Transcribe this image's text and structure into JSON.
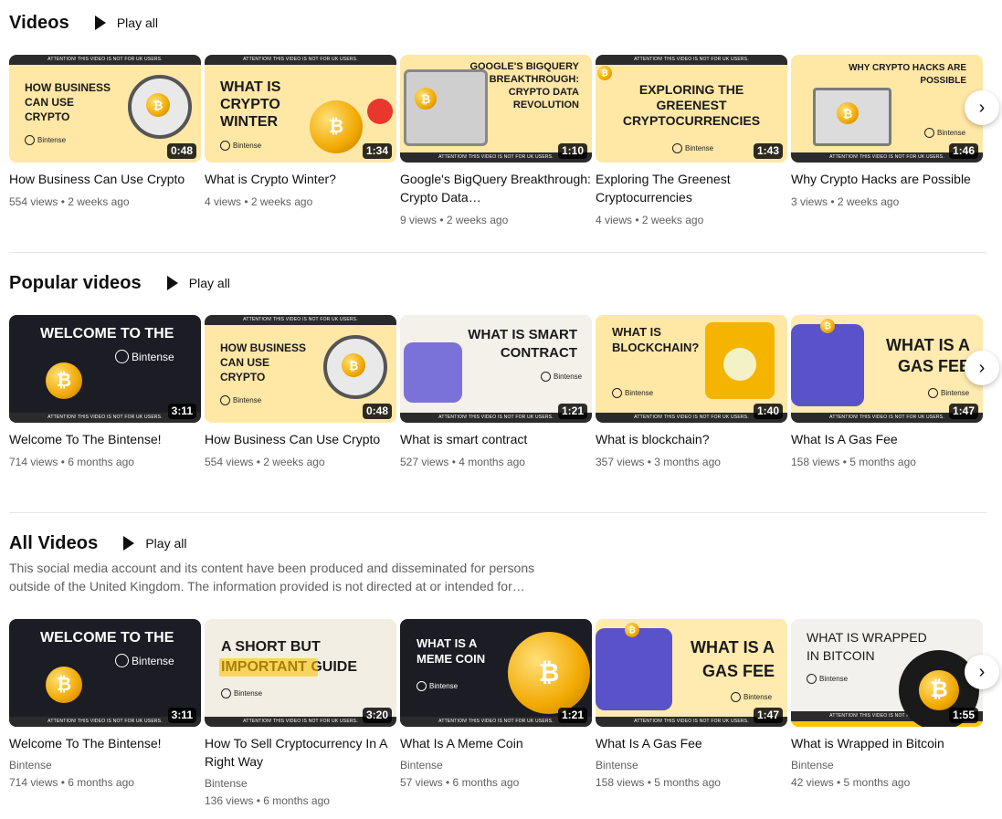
{
  "sections": [
    {
      "title": "Videos",
      "play_all": "Play all",
      "videos": [
        {
          "thumb_text": "HOW BUSINESS\nCAN USE\nCRYPTO",
          "attention": "ATTENTION! THIS VIDEO IS NOT FOR UK USERS.",
          "brand": "Bintense",
          "duration": "0:48",
          "title": "How Business Can Use Crypto",
          "meta": "554 views • 2 weeks ago"
        },
        {
          "thumb_text": "WHAT IS\nCRYPTO\nWINTER",
          "attention": "ATTENTION! THIS VIDEO IS NOT FOR UK USERS.",
          "brand": "Bintense",
          "duration": "1:34",
          "title": "What is Crypto Winter?",
          "meta": "4 views • 2 weeks ago"
        },
        {
          "thumb_text": "GOOGLE'S BIGQUERY\nBREAKTHROUGH:\nCRYPTO DATA\nREVOLUTION",
          "attention": "ATTENTION! THIS VIDEO IS NOT FOR UK USERS.",
          "brand": "",
          "duration": "1:10",
          "title": "Google's BigQuery Breakthrough: Crypto Data…",
          "meta": "9 views • 2 weeks ago"
        },
        {
          "thumb_text": "EXPLORING THE\nGREENEST\nCRYPTOCURRENCIES",
          "attention": "ATTENTION! THIS VIDEO IS NOT FOR UK USERS.",
          "brand": "Bintense",
          "duration": "1:43",
          "title": "Exploring The Greenest Cryptocurrencies",
          "meta": "4 views • 2 weeks ago"
        },
        {
          "thumb_text": "WHY CRYPTO HACKS ARE\nPOSSIBLE",
          "attention": "ATTENTION! THIS VIDEO IS NOT FOR UK USERS.",
          "brand": "Bintense",
          "duration": "1:46",
          "title": "Why Crypto Hacks are Possible",
          "meta": "3 views • 2 weeks ago"
        }
      ]
    },
    {
      "title": "Popular videos",
      "play_all": "Play all",
      "videos": [
        {
          "thumb_text": "WELCOME TO THE",
          "attention": "ATTENTION! THIS VIDEO IS NOT FOR UK USERS.",
          "brand": "Bintense",
          "duration": "3:11",
          "title": "Welcome To The Bintense!",
          "meta": "714 views • 6 months ago"
        },
        {
          "thumb_text": "HOW BUSINESS\nCAN USE\nCRYPTO",
          "attention": "ATTENTION! THIS VIDEO IS NOT FOR UK USERS.",
          "brand": "Bintense",
          "duration": "0:48",
          "title": "How Business Can Use Crypto",
          "meta": "554 views • 2 weeks ago"
        },
        {
          "thumb_text": "WHAT IS SMART\nCONTRACT",
          "attention": "ATTENTION! THIS VIDEO IS NOT FOR UK USERS.",
          "brand": "Bintense",
          "duration": "1:21",
          "title": "What is smart contract",
          "meta": "527 views • 4 months ago"
        },
        {
          "thumb_text": "WHAT IS\nBLOCKCHAIN?",
          "attention": "ATTENTION! THIS VIDEO IS NOT FOR UK USERS.",
          "brand": "Bintense",
          "duration": "1:40",
          "title": "What is blockchain?",
          "meta": "357 views • 3 months ago"
        },
        {
          "thumb_text": "WHAT IS A\nGAS FEE",
          "attention": "ATTENTION! THIS VIDEO IS NOT FOR UK USERS.",
          "brand": "Bintense",
          "duration": "1:47",
          "title": "What Is A Gas Fee",
          "meta": "158 views • 5 months ago"
        }
      ]
    },
    {
      "title": "All Videos",
      "play_all": "Play all",
      "description": "This social media account and its content have been produced and disseminated for persons outside of the United Kingdom. The information provided is not directed at or intended for…",
      "videos": [
        {
          "thumb_text": "WELCOME TO THE",
          "attention": "ATTENTION! THIS VIDEO IS NOT FOR UK USERS.",
          "brand": "Bintense",
          "duration": "3:11",
          "title": "Welcome To The Bintense!",
          "channel": "Bintense",
          "meta": "714 views • 6 months ago"
        },
        {
          "thumb_text": "A SHORT BUT\nIMPORTANT GUIDE",
          "attention": "ATTENTION! THIS VIDEO IS NOT FOR UK USERS.",
          "brand": "Bintense",
          "duration": "3:20",
          "title": "How To Sell Cryptocurrency In A Right Way",
          "channel": "Bintense",
          "meta": "136 views • 6 months ago"
        },
        {
          "thumb_text": "WHAT IS A\nMEME COIN",
          "attention": "ATTENTION! THIS VIDEO IS NOT FOR UK USERS.",
          "brand": "Bintense",
          "duration": "1:21",
          "title": "What Is A Meme Coin",
          "channel": "Bintense",
          "meta": "57 views • 6 months ago"
        },
        {
          "thumb_text": "WHAT IS A\nGAS FEE",
          "attention": "ATTENTION! THIS VIDEO IS NOT FOR UK USERS.",
          "brand": "Bintense",
          "duration": "1:47",
          "title": "What Is A Gas Fee",
          "channel": "Bintense",
          "meta": "158 views • 5 months ago"
        },
        {
          "thumb_text": "WHAT IS WRAPPED\nIN BITCOIN",
          "attention": "ATTENTION! THIS VIDEO IS NOT FOR UK USERS.",
          "brand": "Bintense",
          "duration": "1:55",
          "title": "What is Wrapped in Bitcoin",
          "channel": "Bintense",
          "meta": "42 views • 5 months ago"
        }
      ]
    }
  ],
  "icons": {
    "play": "play-icon",
    "next": "chevron-right-icon",
    "coin_symbol": "₿",
    "next_glyph": "›"
  },
  "colors": {
    "thumb_yellow": "#ffe7a6",
    "thumb_dark": "#1c1c24",
    "accent_yellow": "#ffc400",
    "meta_gray": "#606060"
  }
}
